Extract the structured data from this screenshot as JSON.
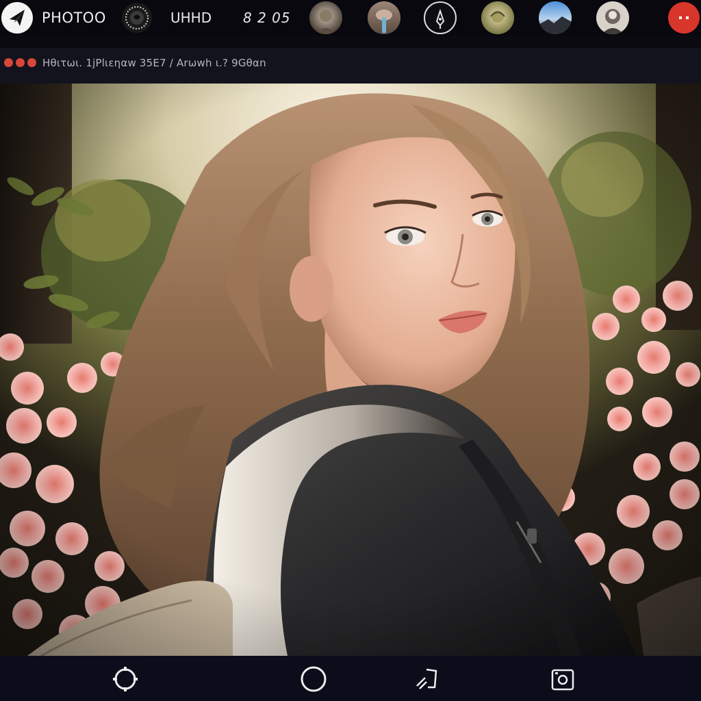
{
  "header": {
    "app_logo_icon": "paper-plane-icon",
    "app_name": "PHOTOO",
    "quality_label": "UHHD",
    "counter_label": "8 2 05",
    "record_button_color": "#d9362b"
  },
  "subbar": {
    "window_dot_color": "#d8473a",
    "breadcrumb": "Ηθιτωι. 1ϳΡlιεηαw 35Ε7 / Αrωwh ι.? 9Gθαn"
  },
  "toolbar_icons": [
    "filter-ring-icon",
    "avatar-1",
    "avatar-2",
    "edit-pen-icon",
    "avatar-3",
    "avatar-4",
    "avatar-5"
  ],
  "bottom_bar": {
    "icons": [
      "settings-ring-icon",
      "shutter-circle-icon",
      "crop-arrow-icon",
      "camera-icon"
    ]
  },
  "canvas": {
    "content": "portrait-photo",
    "palette": {
      "hair": "#8e6a4c",
      "skin": "#e8b89c",
      "flowers": "#f2a6a0",
      "jacket": "#2a2a2c",
      "foliage": "#3c4a24"
    }
  }
}
